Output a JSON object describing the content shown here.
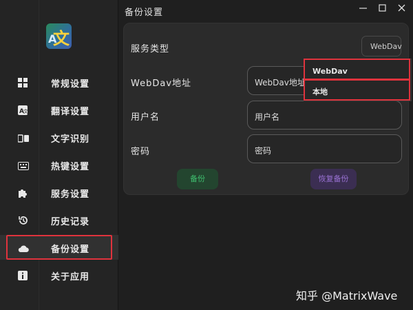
{
  "window": {
    "title": "备份设置"
  },
  "sidebar": {
    "items": [
      {
        "label": "常规设置",
        "icon": "grid-icon"
      },
      {
        "label": "翻译设置",
        "icon": "translate-icon"
      },
      {
        "label": "文字识别",
        "icon": "ocr-icon"
      },
      {
        "label": "热键设置",
        "icon": "keyboard-icon"
      },
      {
        "label": "服务设置",
        "icon": "puzzle-icon"
      },
      {
        "label": "历史记录",
        "icon": "history-icon"
      },
      {
        "label": "备份设置",
        "icon": "cloud-icon",
        "active": true
      },
      {
        "label": "关于应用",
        "icon": "info-icon"
      }
    ]
  },
  "form": {
    "service_type_label": "服务类型",
    "service_type_value": "WebDav",
    "url_label": "WebDav地址",
    "url_placeholder": "WebDav地址",
    "username_label": "用户名",
    "username_placeholder": "用户名",
    "password_label": "密码",
    "password_placeholder": "密码",
    "backup_label": "备份",
    "restore_label": "恢复备份"
  },
  "dropdown": {
    "options": [
      "WebDav",
      "本地"
    ]
  },
  "watermark": "知乎 @MatrixWave",
  "colors": {
    "accent_red": "#e0333d",
    "backup_green": "#3fbf6f",
    "restore_purple": "#9a72d4"
  }
}
